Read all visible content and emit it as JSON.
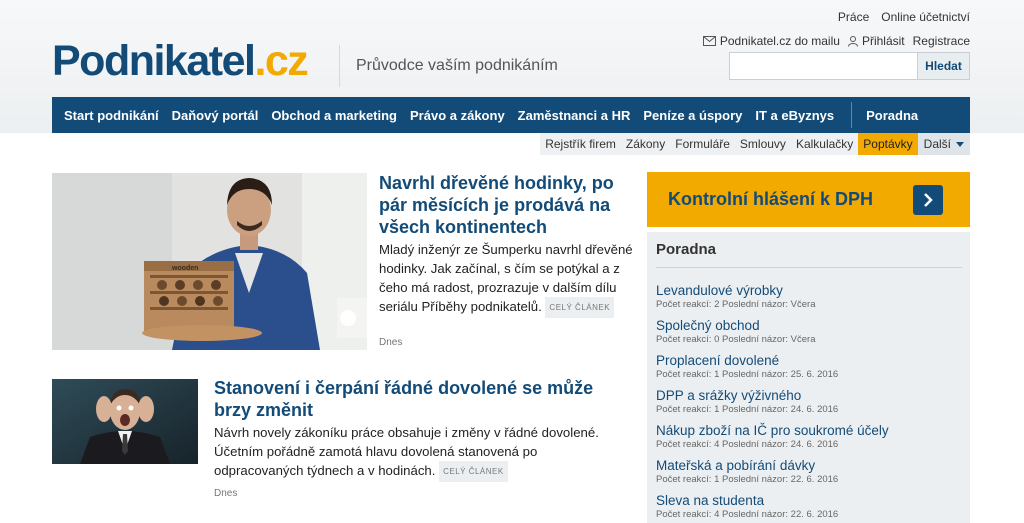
{
  "header": {
    "logo_main": "Podnikatel",
    "logo_tld": ".cz",
    "slogan": "Průvodce vaším podnikáním",
    "top_links": [
      "Práce",
      "Online účetnictví"
    ],
    "mail_link": "Podnikatel.cz do mailu",
    "login": "Přihlásit",
    "register": "Registrace",
    "search_placeholder": "",
    "search_button": "Hledat"
  },
  "main_nav": [
    "Start podnikání",
    "Daňový portál",
    "Obchod a marketing",
    "Právo a zákony",
    "Zaměstnanci a HR",
    "Peníze a úspory",
    "IT a eByznys"
  ],
  "main_nav_extra": "Poradna",
  "sub_nav": [
    "Rejstřík firem",
    "Zákony",
    "Formuláře",
    "Smlouvy",
    "Kalkulačky",
    "Poptávky"
  ],
  "sub_nav_more": "Další",
  "articles": [
    {
      "title": "Navrhl dřevěné hodinky, po pár měsících je prodává na všech kontinentech",
      "perex": "Mladý inženýr ze Šumperku navrhl dřevěné hodinky. Jak začínal, s čím se potýkal a z čeho má radost, prozrazuje v dalším dílu seriálu Příběhy podnikatelů.",
      "badge": "CELÝ ČLÁNEK",
      "date": "Dnes",
      "image_sign": "wooden"
    },
    {
      "title": "Stanovení i čerpání řádné dovolené se může brzy změnit",
      "perex": "Návrh novely zákoníku práce obsahuje i změny v řádné dovolené. Účetním pořádně zamotá hlavu dovolená stanovená po odpracovaných týdnech a v hodinách.",
      "badge": "CELÝ ČLÁNEK",
      "date": "Dnes"
    }
  ],
  "sidebar": {
    "banner": "Kontrolní hlášení k DPH",
    "poradna_title": "Poradna",
    "questions": [
      {
        "title": "Levandulové výrobky",
        "meta": "Počet reakcí: 2  Poslední názor: Včera"
      },
      {
        "title": "Společný obchod",
        "meta": "Počet reakcí: 0  Poslední názor: Včera"
      },
      {
        "title": "Proplacení dovolené",
        "meta": "Počet reakcí: 1  Poslední názor: 25. 6. 2016"
      },
      {
        "title": "DPP a srážky výživného",
        "meta": "Počet reakcí: 1  Poslední názor: 24. 6. 2016"
      },
      {
        "title": "Nákup zboží na IČ pro soukromé účely",
        "meta": "Počet reakcí: 4  Poslední názor: 24. 6. 2016"
      },
      {
        "title": "Mateřská a pobírání dávky",
        "meta": "Počet reakcí: 1  Poslední názor: 22. 6. 2016"
      },
      {
        "title": "Sleva na studenta",
        "meta": "Počet reakcí: 4  Poslední názor: 22. 6. 2016"
      }
    ]
  },
  "colors": {
    "brand": "#134b78",
    "accent": "#f2a900"
  },
  "icons": [
    "mail-icon",
    "user-icon",
    "chevron-right-icon",
    "triangle-down-icon"
  ]
}
